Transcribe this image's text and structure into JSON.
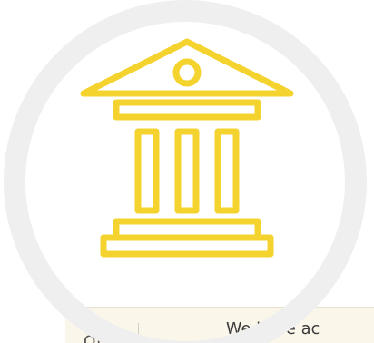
{
  "icon": {
    "name": "bank-building-icon",
    "stroke_color": "#f4d32e",
    "ring_color": "#efefef"
  },
  "panel": {
    "intro_text": "We have ac",
    "label_text": "OUR",
    "background": "#fbf6ea"
  }
}
